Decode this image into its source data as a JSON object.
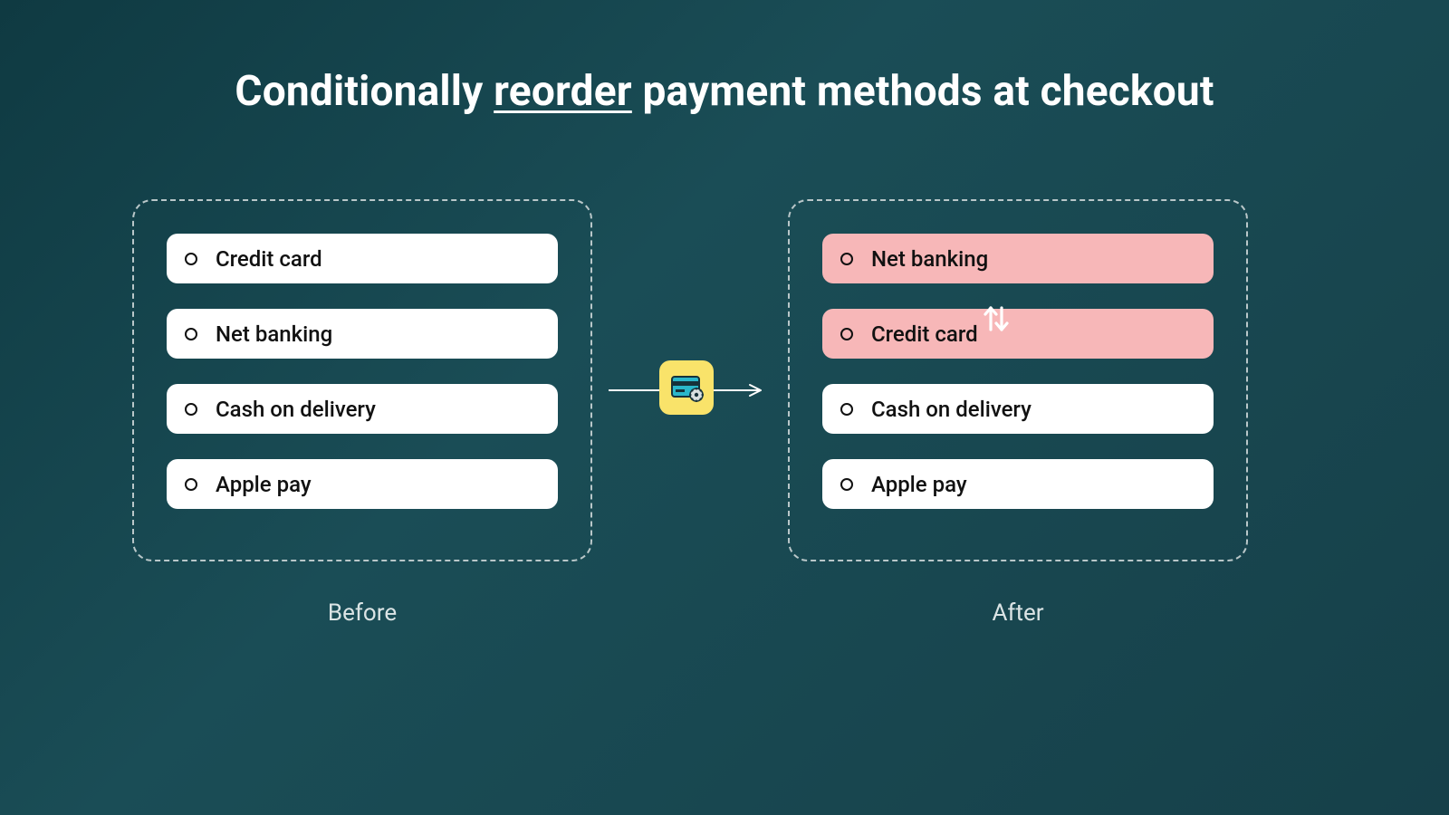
{
  "title": {
    "pre": "Conditionally ",
    "underlined": "reorder",
    "post": " payment methods at checkout"
  },
  "before": {
    "label": "Before",
    "options": [
      {
        "label": "Credit card",
        "highlight": false
      },
      {
        "label": "Net banking",
        "highlight": false
      },
      {
        "label": "Cash on delivery",
        "highlight": false
      },
      {
        "label": "Apple pay",
        "highlight": false
      }
    ]
  },
  "after": {
    "label": "After",
    "options": [
      {
        "label": "Net banking",
        "highlight": true
      },
      {
        "label": "Credit card",
        "highlight": true
      },
      {
        "label": "Cash on delivery",
        "highlight": false
      },
      {
        "label": "Apple pay",
        "highlight": false
      }
    ]
  },
  "colors": {
    "highlight": "#f7b7b8",
    "card_bg": "#ffffff",
    "border": "#b9c7c9",
    "text": "#111111",
    "bg_start": "#0f3a42",
    "bg_end": "#164049",
    "icon_bg": "#f9e36a",
    "card_stripe": "#2ab7ca"
  },
  "icons": {
    "app": "card-settings-icon",
    "swap": "swap-vertical-icon",
    "arrow": "arrow-right-icon"
  }
}
